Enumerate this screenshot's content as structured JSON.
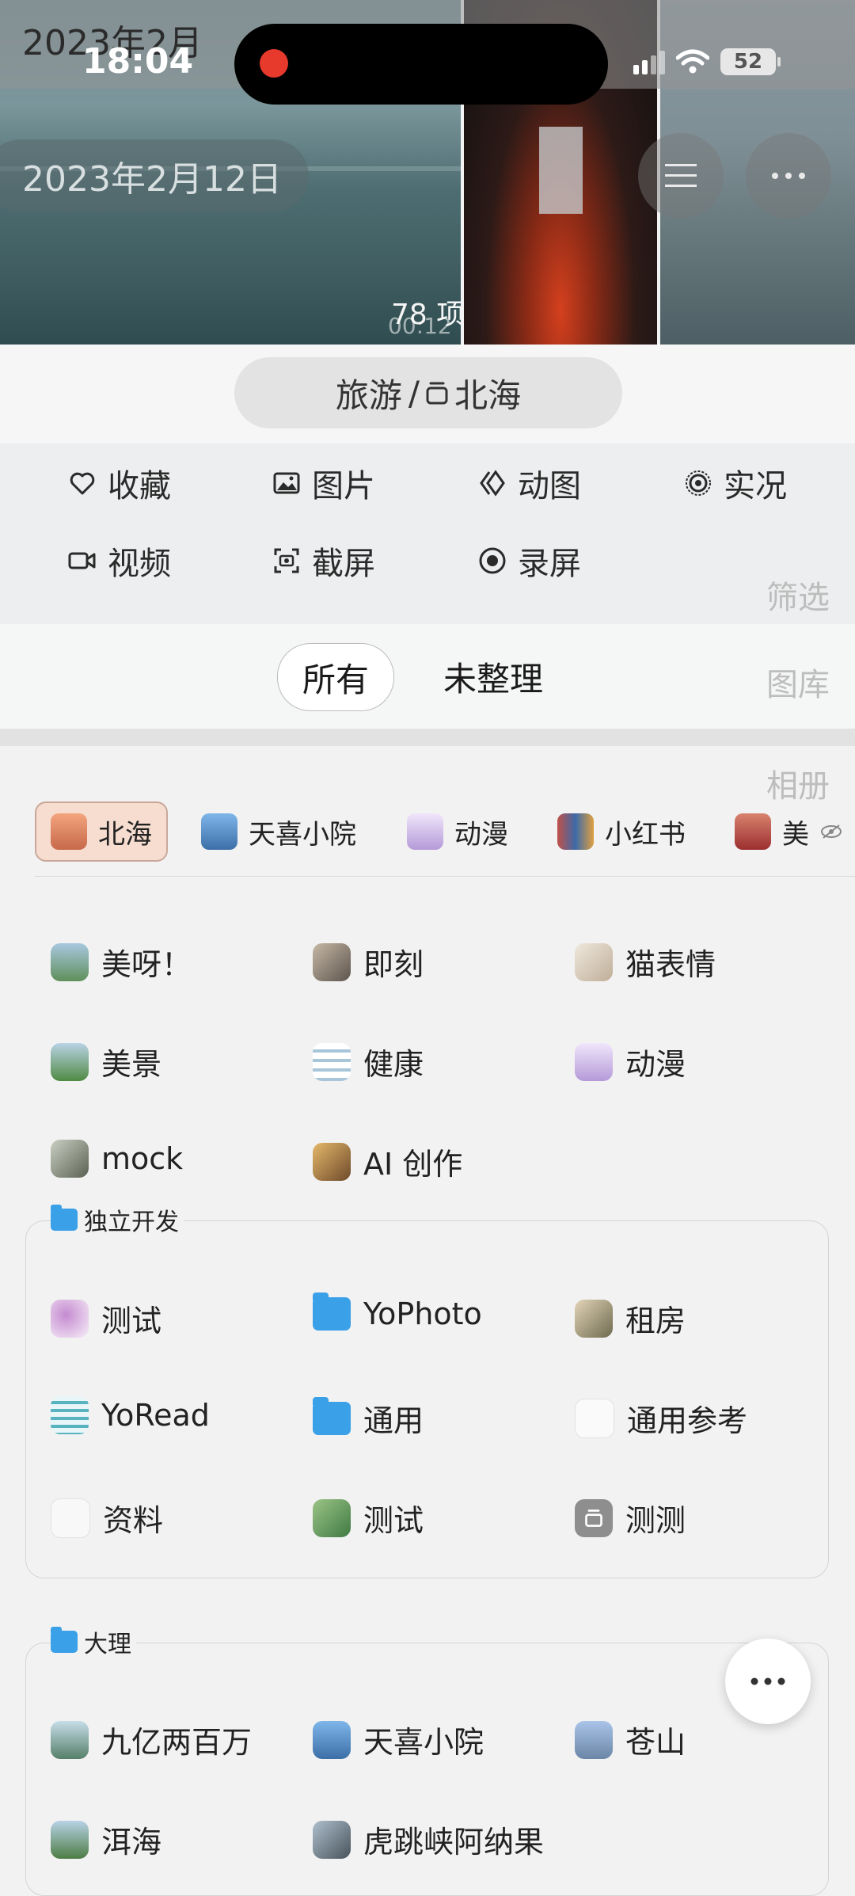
{
  "status_bar": {
    "time": "18:04",
    "battery": "52"
  },
  "header": {
    "month_label": "2023年2月",
    "date_label": "2023年2月12日",
    "item_count": "78 项",
    "video_duration": "00:12"
  },
  "album_title": {
    "parent": "旅游",
    "separator": " / ",
    "name": "北海"
  },
  "filters": [
    {
      "label": "收藏",
      "icon": "heart-icon"
    },
    {
      "label": "图片",
      "icon": "image-icon"
    },
    {
      "label": "动图",
      "icon": "gif-icon"
    },
    {
      "label": "实况",
      "icon": "live-photo-icon"
    },
    {
      "label": "视频",
      "icon": "video-icon"
    },
    {
      "label": "截屏",
      "icon": "screenshot-icon"
    },
    {
      "label": "录屏",
      "icon": "screen-record-icon"
    }
  ],
  "section_labels": {
    "filter": "筛选",
    "library": "图库",
    "albums": "相册"
  },
  "segments": {
    "all": "所有",
    "unorganized": "未整理"
  },
  "chips": [
    {
      "label": "北海",
      "color": "#e7865d"
    },
    {
      "label": "天喜小院",
      "color": "#4f90d0"
    },
    {
      "label": "动漫",
      "color": "#c9b4e8"
    },
    {
      "label": "小红书",
      "color": "#c0504a"
    },
    {
      "label": "美",
      "color": "#b73b3b"
    }
  ],
  "albums": [
    {
      "label": "美呀！",
      "color": "#6f9a6a"
    },
    {
      "label": "即刻",
      "color": "#8b8077"
    },
    {
      "label": "猫表情",
      "color": "#d9cfc2"
    },
    {
      "label": "美景",
      "color": "#86a86a"
    },
    {
      "label": "健康",
      "color": "#cfe0ea"
    },
    {
      "label": "动漫",
      "color": "#c9b4e8"
    },
    {
      "label": "mock",
      "color": "#9ba394"
    },
    {
      "label": "AI 创作",
      "color": "#b8875a"
    }
  ],
  "groups": [
    {
      "title": "独立开发",
      "items": [
        {
          "label": "测试",
          "kind": "thumb",
          "color": "#e2c8e8"
        },
        {
          "label": "YoPhoto",
          "kind": "folder"
        },
        {
          "label": "租房",
          "kind": "thumb",
          "color": "#b59d7b"
        },
        {
          "label": "YoRead",
          "kind": "thumb",
          "color": "#bfe0e4"
        },
        {
          "label": "通用",
          "kind": "folder"
        },
        {
          "label": "通用参考",
          "kind": "thumb",
          "color": "#f7f7f7"
        },
        {
          "label": "资料",
          "kind": "thumb",
          "color": "#f3f3f3"
        },
        {
          "label": "测试",
          "kind": "thumb",
          "color": "#6f9f5f"
        },
        {
          "label": "测测",
          "kind": "thumb",
          "color": "#8e8e8e"
        }
      ]
    },
    {
      "title": "大理",
      "items": [
        {
          "label": "九亿两百万",
          "kind": "thumb",
          "color": "#86a6a0"
        },
        {
          "label": "天喜小院",
          "kind": "thumb",
          "color": "#4f90d0"
        },
        {
          "label": "苍山",
          "kind": "thumb",
          "color": "#8fa9c9"
        },
        {
          "label": "洱海",
          "kind": "thumb",
          "color": "#6f9a6a"
        },
        {
          "label": "虎跳峡阿纳果",
          "kind": "thumb",
          "color": "#7d8d99"
        }
      ]
    }
  ]
}
